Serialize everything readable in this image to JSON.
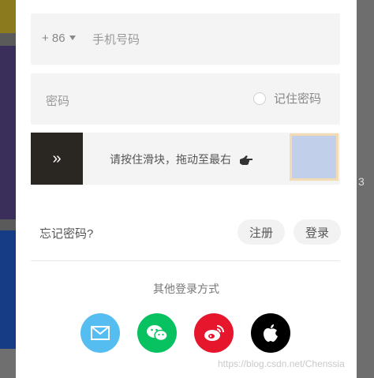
{
  "background": {
    "right_number": "3"
  },
  "phone": {
    "prefix": "+ 86",
    "placeholder": "手机号码"
  },
  "password": {
    "placeholder": "密码",
    "remember_label": "记住密码"
  },
  "slider": {
    "handle_glyph": "»",
    "instruction": "请按住滑块，拖动至最右"
  },
  "actions": {
    "forgot": "忘记密码?",
    "register": "注册",
    "login": "登录"
  },
  "social": {
    "title": "其他登录方式",
    "items": [
      "mail-icon",
      "wechat-icon",
      "weibo-icon",
      "apple-icon"
    ]
  },
  "watermark": "https://blog.csdn.net/Chenssia",
  "colors": {
    "mail": "#56bdf1",
    "wechat": "#08c160",
    "weibo": "#e6162d",
    "apple": "#000000",
    "handle": "#2a2622",
    "target": "#c2cfea"
  }
}
